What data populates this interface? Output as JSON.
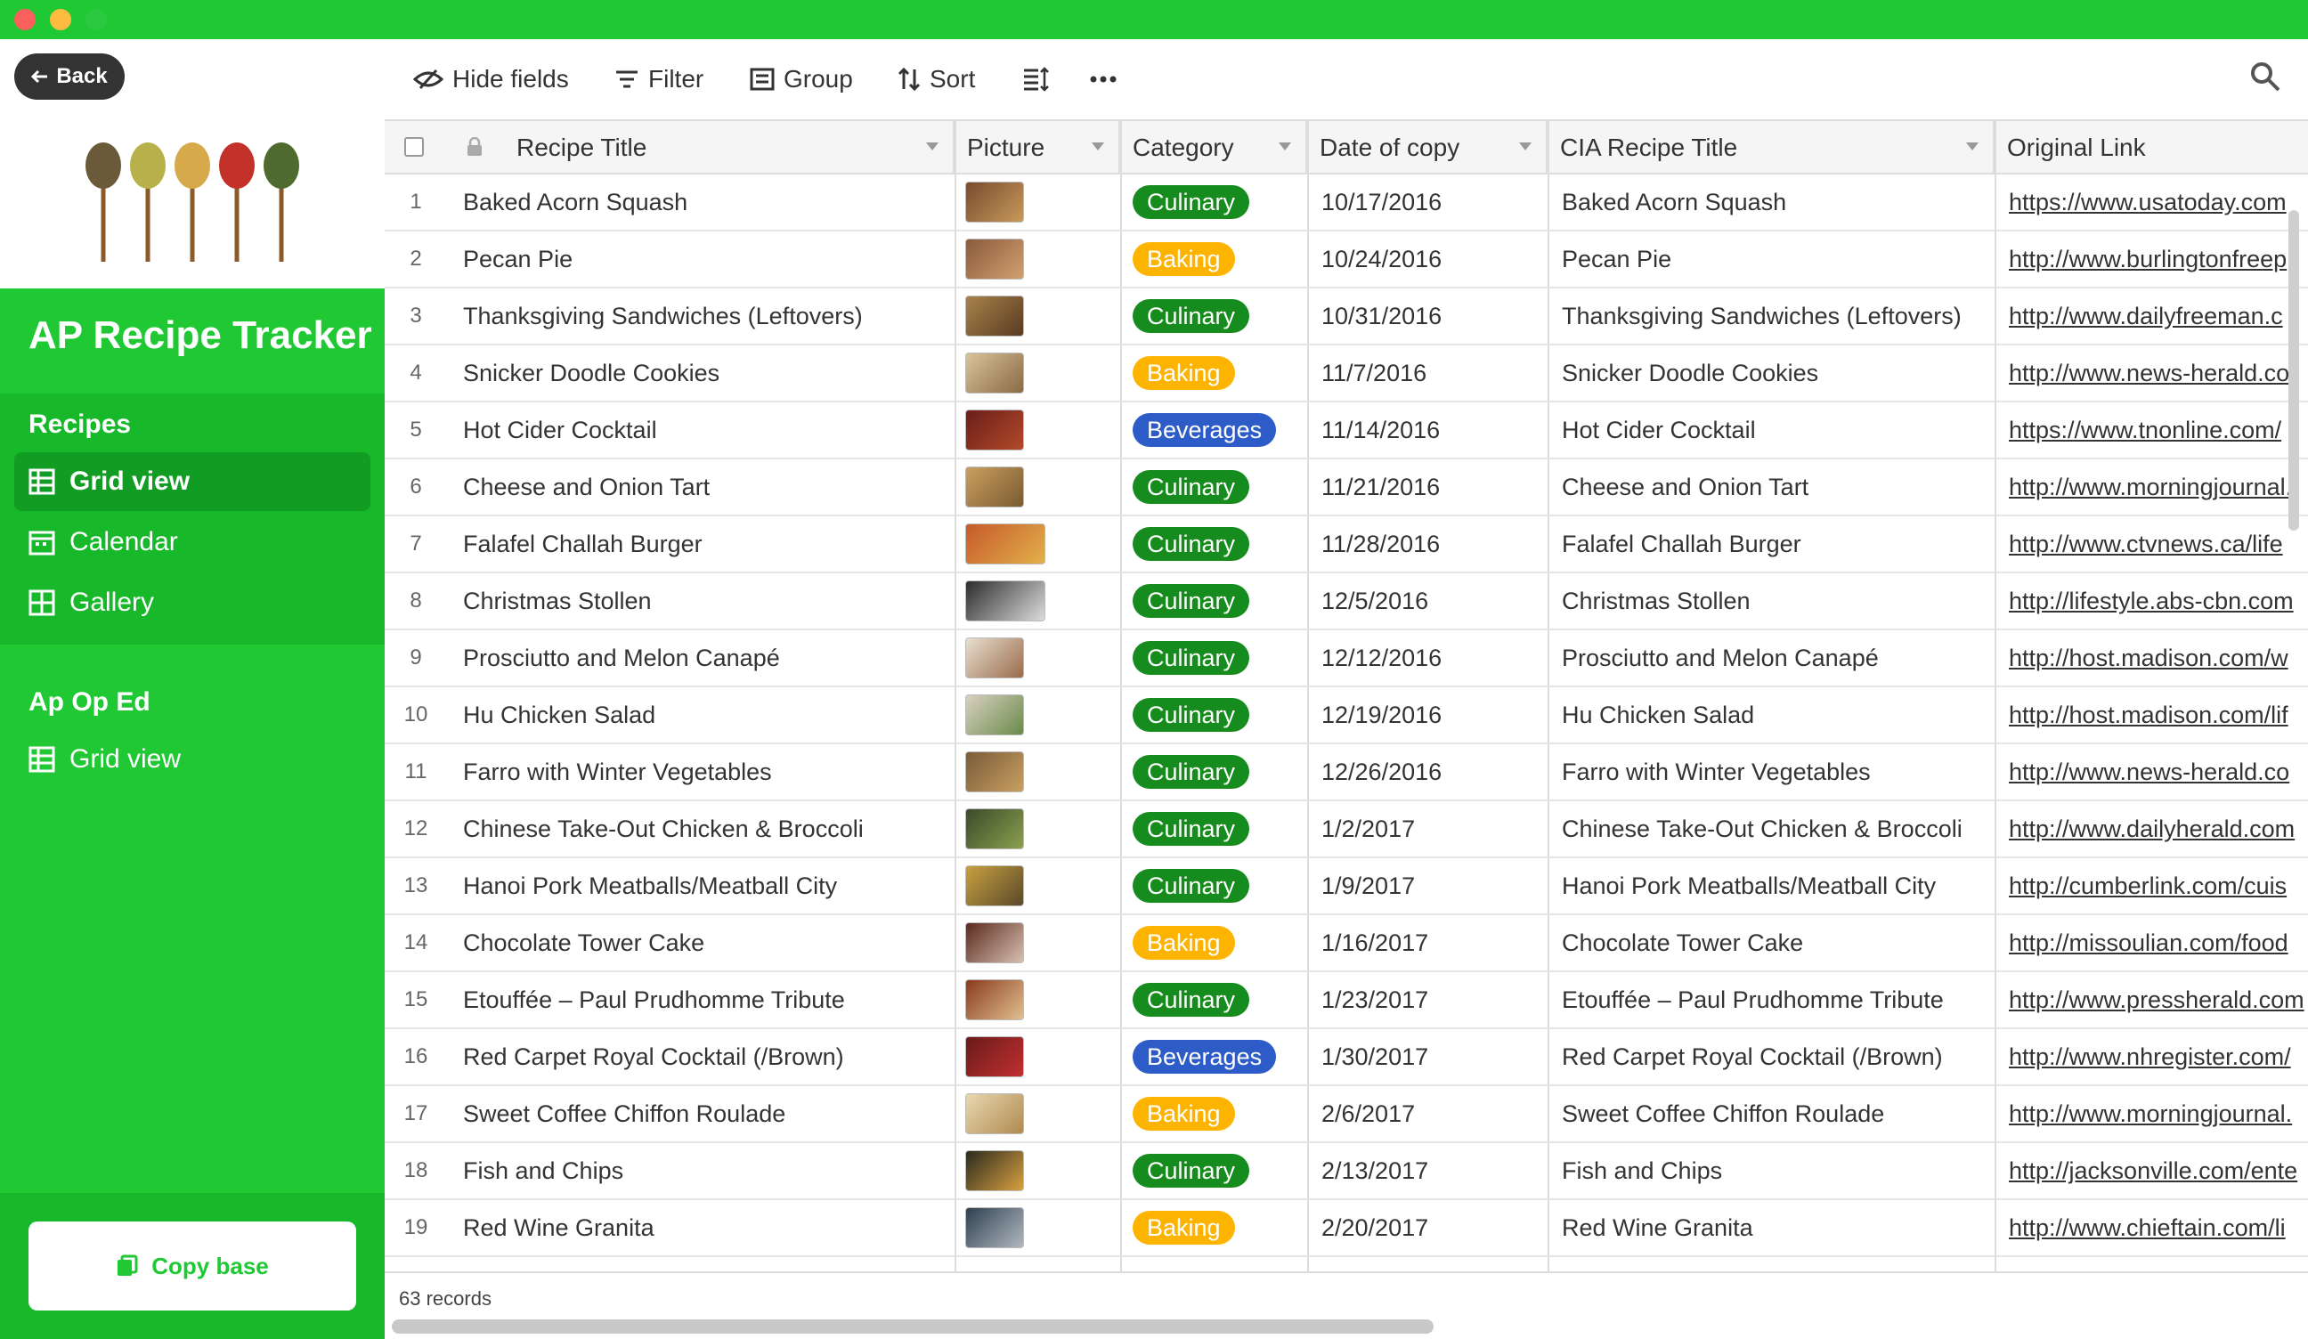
{
  "toolbar": {
    "back": "Back",
    "hide_fields": "Hide fields",
    "filter": "Filter",
    "group": "Group",
    "sort": "Sort"
  },
  "app_title": "AP Recipe Tracker",
  "sidebar": {
    "section1": "Recipes",
    "views1": [
      "Grid view",
      "Calendar",
      "Gallery"
    ],
    "section2": "Ap Op Ed",
    "views2": [
      "Grid view"
    ],
    "copy_base": "Copy base"
  },
  "columns": [
    "Recipe Title",
    "Picture",
    "Category",
    "Date of copy",
    "CIA Recipe Title",
    "Original Link"
  ],
  "colors": {
    "culinary": "#168b1e",
    "baking": "#fcb400",
    "beverages": "#2d5bc8",
    "brand": "#20c933"
  },
  "rows": [
    {
      "n": "1",
      "title": "Baked Acorn Squash",
      "cat": "Culinary",
      "date": "10/17/2016",
      "cia": "Baked Acorn Squash",
      "link": "https://www.usatoday.com"
    },
    {
      "n": "2",
      "title": "Pecan Pie",
      "cat": "Baking",
      "date": "10/24/2016",
      "cia": "Pecan Pie",
      "link": "http://www.burlingtonfreep"
    },
    {
      "n": "3",
      "title": "Thanksgiving Sandwiches (Leftovers)",
      "cat": "Culinary",
      "date": "10/31/2016",
      "cia": "Thanksgiving Sandwiches (Leftovers)",
      "link": "http://www.dailyfreeman.c"
    },
    {
      "n": "4",
      "title": "Snicker Doodle Cookies",
      "cat": "Baking",
      "date": "11/7/2016",
      "cia": "Snicker Doodle Cookies",
      "link": "http://www.news-herald.co"
    },
    {
      "n": "5",
      "title": "Hot Cider Cocktail",
      "cat": "Beverages",
      "date": "11/14/2016",
      "cia": "Hot Cider Cocktail",
      "link": "https://www.tnonline.com/"
    },
    {
      "n": "6",
      "title": "Cheese and Onion Tart",
      "cat": "Culinary",
      "date": "11/21/2016",
      "cia": "Cheese and Onion Tart",
      "link": "http://www.morningjournal."
    },
    {
      "n": "7",
      "title": "Falafel Challah Burger",
      "cat": "Culinary",
      "date": "11/28/2016",
      "cia": "Falafel Challah Burger",
      "link": "http://www.ctvnews.ca/life"
    },
    {
      "n": "8",
      "title": "Christmas Stollen",
      "cat": "Culinary",
      "date": "12/5/2016",
      "cia": "Christmas Stollen",
      "link": "http://lifestyle.abs-cbn.com"
    },
    {
      "n": "9",
      "title": "Prosciutto and Melon Canapé",
      "cat": "Culinary",
      "date": "12/12/2016",
      "cia": "Prosciutto and Melon Canapé",
      "link": "http://host.madison.com/w"
    },
    {
      "n": "10",
      "title": "Hu Chicken Salad",
      "cat": "Culinary",
      "date": "12/19/2016",
      "cia": "Hu Chicken Salad",
      "link": "http://host.madison.com/lif"
    },
    {
      "n": "11",
      "title": "Farro with Winter Vegetables",
      "cat": "Culinary",
      "date": "12/26/2016",
      "cia": "Farro with Winter Vegetables",
      "link": "http://www.news-herald.co"
    },
    {
      "n": "12",
      "title": "Chinese Take-Out Chicken & Broccoli",
      "cat": "Culinary",
      "date": "1/2/2017",
      "cia": "Chinese Take-Out Chicken & Broccoli",
      "link": "http://www.dailyherald.com"
    },
    {
      "n": "13",
      "title": "Hanoi Pork Meatballs/Meatball City",
      "cat": "Culinary",
      "date": "1/9/2017",
      "cia": "Hanoi Pork Meatballs/Meatball City",
      "link": "http://cumberlink.com/cuis"
    },
    {
      "n": "14",
      "title": "Chocolate Tower Cake",
      "cat": "Baking",
      "date": "1/16/2017",
      "cia": "Chocolate Tower Cake",
      "link": "http://missoulian.com/food"
    },
    {
      "n": "15",
      "title": "Etouffée – Paul Prudhomme Tribute",
      "cat": "Culinary",
      "date": "1/23/2017",
      "cia": "Etouffée – Paul Prudhomme Tribute",
      "link": "http://www.pressherald.com"
    },
    {
      "n": "16",
      "title": "Red Carpet Royal Cocktail (/Brown)",
      "cat": "Beverages",
      "date": "1/30/2017",
      "cia": "Red Carpet Royal Cocktail (/Brown)",
      "link": "http://www.nhregister.com/"
    },
    {
      "n": "17",
      "title": "Sweet Coffee Chiffon Roulade",
      "cat": "Baking",
      "date": "2/6/2017",
      "cia": "Sweet Coffee Chiffon Roulade",
      "link": "http://www.morningjournal."
    },
    {
      "n": "18",
      "title": "Fish and Chips",
      "cat": "Culinary",
      "date": "2/13/2017",
      "cia": "Fish and Chips",
      "link": "http://jacksonville.com/ente"
    },
    {
      "n": "19",
      "title": "Red Wine Granita",
      "cat": "Baking",
      "date": "2/20/2017",
      "cia": "Red Wine Granita",
      "link": "http://www.chieftain.com/li"
    }
  ],
  "footer": {
    "records": "63 records"
  }
}
